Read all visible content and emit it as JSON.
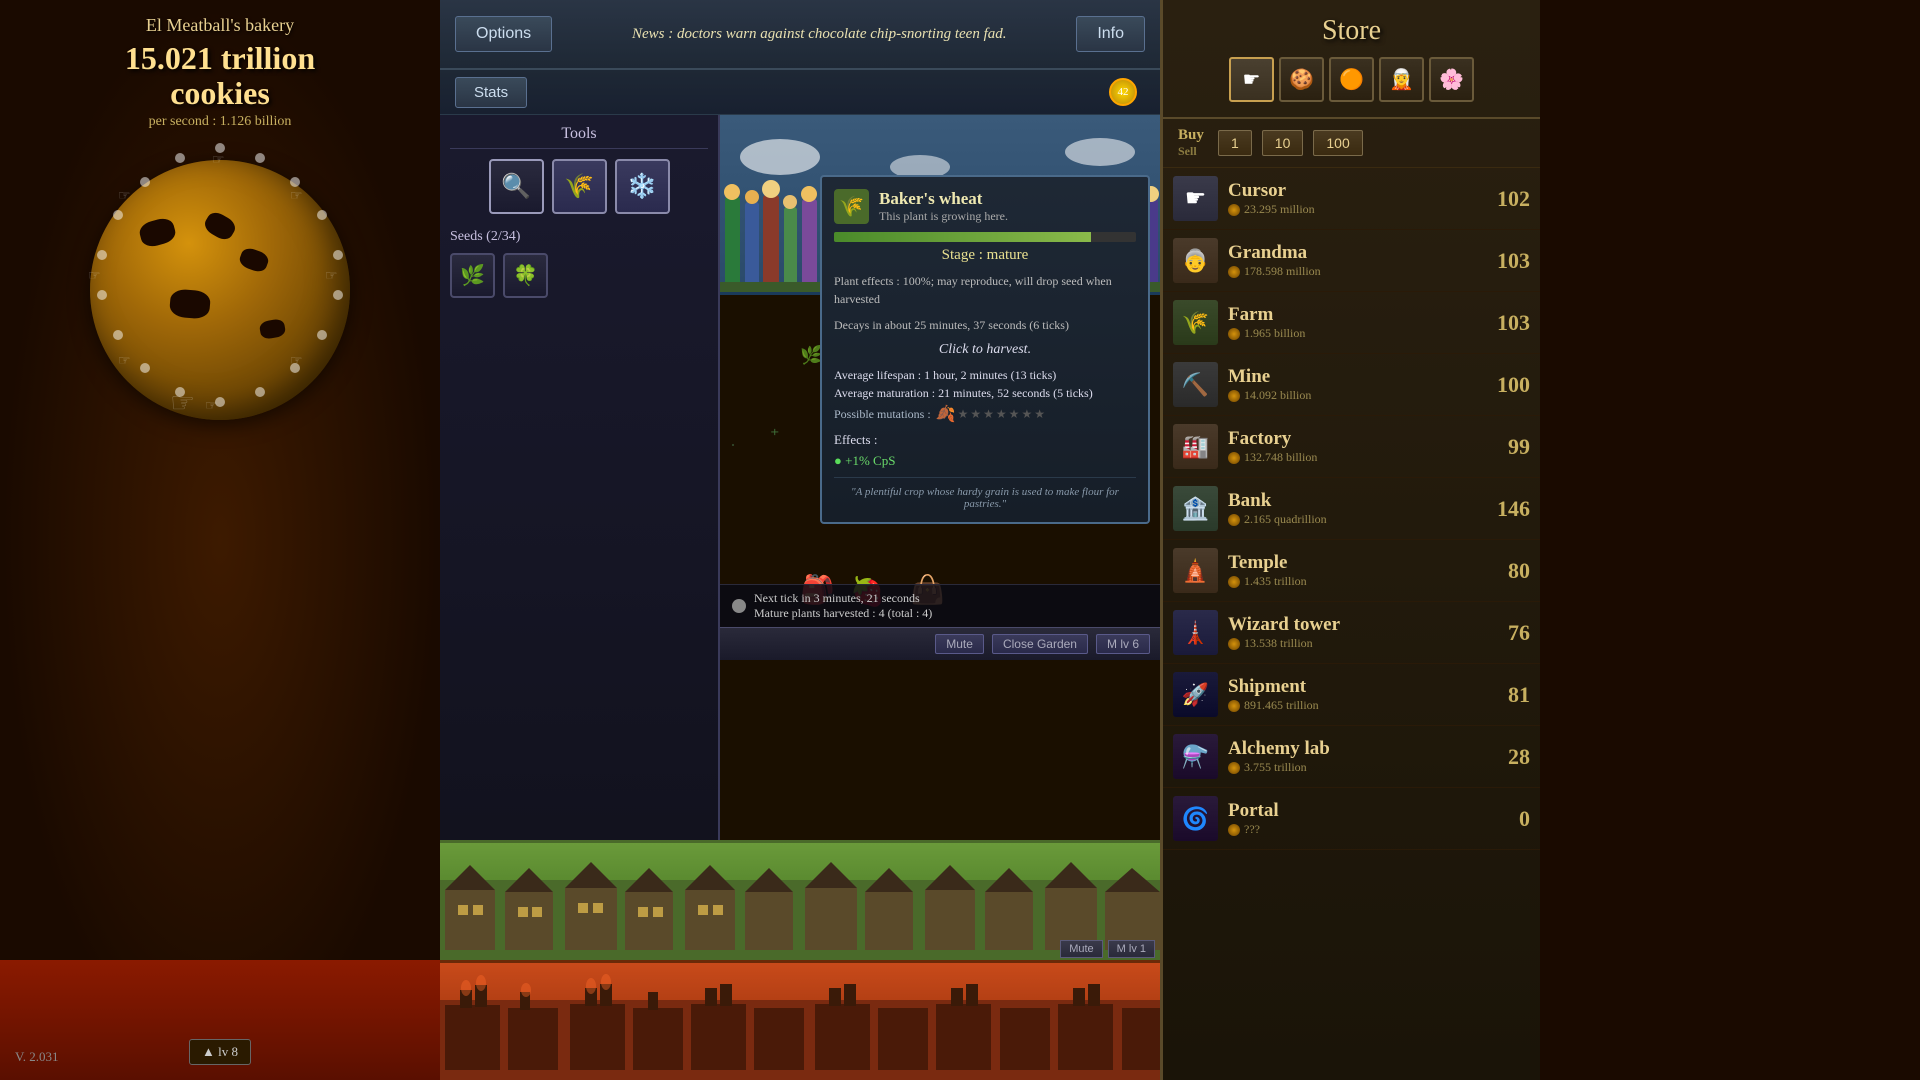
{
  "bakery": {
    "name": "El Meatball's bakery",
    "cookies": "15.021 trillion",
    "cookies_unit": "cookies",
    "per_second_label": "per second : 1.126 billion"
  },
  "topbar": {
    "options_label": "Options",
    "stats_label": "Stats",
    "info_label": "Info",
    "news": "News : doctors warn against chocolate chip-snorting teen fad.",
    "golden_count": "42"
  },
  "tools": {
    "title": "Tools",
    "seeds_label": "Seeds (2/34)"
  },
  "tooltip": {
    "plant_name": "Baker's wheat",
    "plant_subtitle": "This plant is growing here.",
    "stage_label": "Stage :",
    "stage_value": "mature",
    "effects_text": "Plant effects : 100%; may reproduce, will drop seed when harvested",
    "decay_text": "Decays in about 25 minutes, 37 seconds (6 ticks)",
    "action": "Click to harvest.",
    "avg_lifespan_label": "Average lifespan :",
    "avg_lifespan_value": "1 hour, 2 minutes (13 ticks)",
    "avg_maturation_label": "Average maturation :",
    "avg_maturation_value": "21 minutes, 52 seconds (5 ticks)",
    "possible_mutations_label": "Possible mutations :",
    "effects_label": "Effects :",
    "effect_value": "+1% CpS",
    "quote": "\"A plentiful crop whose hardy grain is used to make flour for pastries.\""
  },
  "garden_status": {
    "tick_text": "Next tick in 3 minutes, 21 seconds",
    "harvest_text": "Mature plants harvested : 4 (total : 4)"
  },
  "garden_controls": {
    "mute": "Mute",
    "close": "Close Garden",
    "level": "M lv 6"
  },
  "bottom_scene1": {
    "mute": "Mute",
    "level": "M lv 1"
  },
  "bottom_scene2": {
    "level": "lv 8"
  },
  "store": {
    "title": "Store",
    "buy_label": "Buy",
    "sell_label": "Sell",
    "qty_options": [
      "1",
      "10",
      "100"
    ],
    "items": [
      {
        "name": "Cursor",
        "cost": "23.295 million",
        "count": "102",
        "icon": "👆"
      },
      {
        "name": "Grandma",
        "cost": "178.598 million",
        "count": "103",
        "icon": "👵"
      },
      {
        "name": "Farm",
        "cost": "1.965 billion",
        "count": "103",
        "icon": "🌾"
      },
      {
        "name": "Mine",
        "cost": "14.092 billion",
        "count": "100",
        "icon": "⛏"
      },
      {
        "name": "Factory",
        "cost": "132.748 billion",
        "count": "99",
        "icon": "🏭"
      },
      {
        "name": "Bank",
        "cost": "2.165 quadrillion",
        "count": "146",
        "icon": "🏦"
      },
      {
        "name": "Temple",
        "cost": "1.435 trillion",
        "count": "80",
        "icon": "🛕"
      },
      {
        "name": "Wizard tower",
        "cost": "13.538 trillion",
        "count": "76",
        "icon": "🗼"
      },
      {
        "name": "Shipment",
        "cost": "891.465 trillion",
        "count": "81",
        "icon": "🚀"
      },
      {
        "name": "Alchemy lab",
        "cost": "3.755 trillion",
        "count": "28",
        "icon": "⚗️"
      },
      {
        "name": "Portal",
        "cost": "???",
        "count": "0",
        "icon": "🌀"
      }
    ]
  },
  "version": "V. 2.031",
  "level_badge": "lv 8"
}
